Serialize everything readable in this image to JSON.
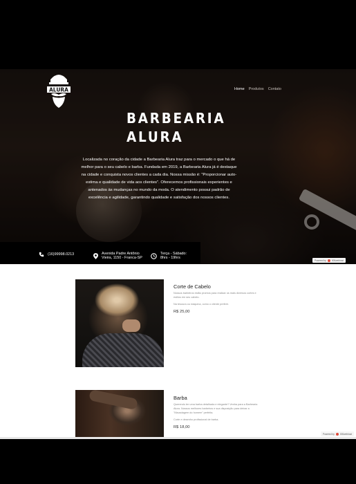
{
  "brand": {
    "name": "ALURA"
  },
  "nav": {
    "items": [
      "Home",
      "Produtos",
      "Contato"
    ]
  },
  "hero": {
    "title_line1": "BARBEARIA",
    "title_line2": "ALURA",
    "intro": "Localizada no coração da cidade a Barbearia Alura traz para o mercado o que há de melhor para o seu cabelo e barba. Fundada em 2019, a Barbearia Alura já é destaque na cidade e conquista novos clientes a cada dia. Nossa missão é: \"Proporcionar auto-estima e qualidade de vida aos clientes\". Oferecemos profissionais experientes e antenados às mudanças no mundo da moda. O atendimento possui padrão de excelência e agilidade, garantindo qualidade e satisfação dos nossos clientes."
  },
  "info": {
    "phone": "(16)99998.0213",
    "address_line1": "Avenida Padre Antônio",
    "address_line2": "Vieira, 1150 - Franca-SP",
    "hours_line1": "Terça - Sábado:",
    "hours_line2": "8hrs - 19hrs"
  },
  "badge": {
    "label": "Powered by",
    "brand": "000webhost"
  },
  "services": [
    {
      "title": "Corte de Cabelo",
      "description": "Nossos barbeiros estão prontos para realizar os mais diversos cortes e estilos em seu cabelo.",
      "note": "Na tesoura ou máquina, como o cliente preferir.",
      "price": "R$ 25,00"
    },
    {
      "title": "Barba",
      "description": "Querendo ter uma barba detalhada e elegante? Venha para a Barbearia Alura. Nossos melhores barbeiros e sua disposição para deixar a \"Mausdagem do homem\" perfeita.",
      "note": "Corte e desenho profissional de barba.",
      "price": "R$ 18,00"
    }
  ],
  "colors": {
    "hero_bg": "#1e1612",
    "content_bg": "#ffffff",
    "badge_dot": "#e04b3a"
  }
}
